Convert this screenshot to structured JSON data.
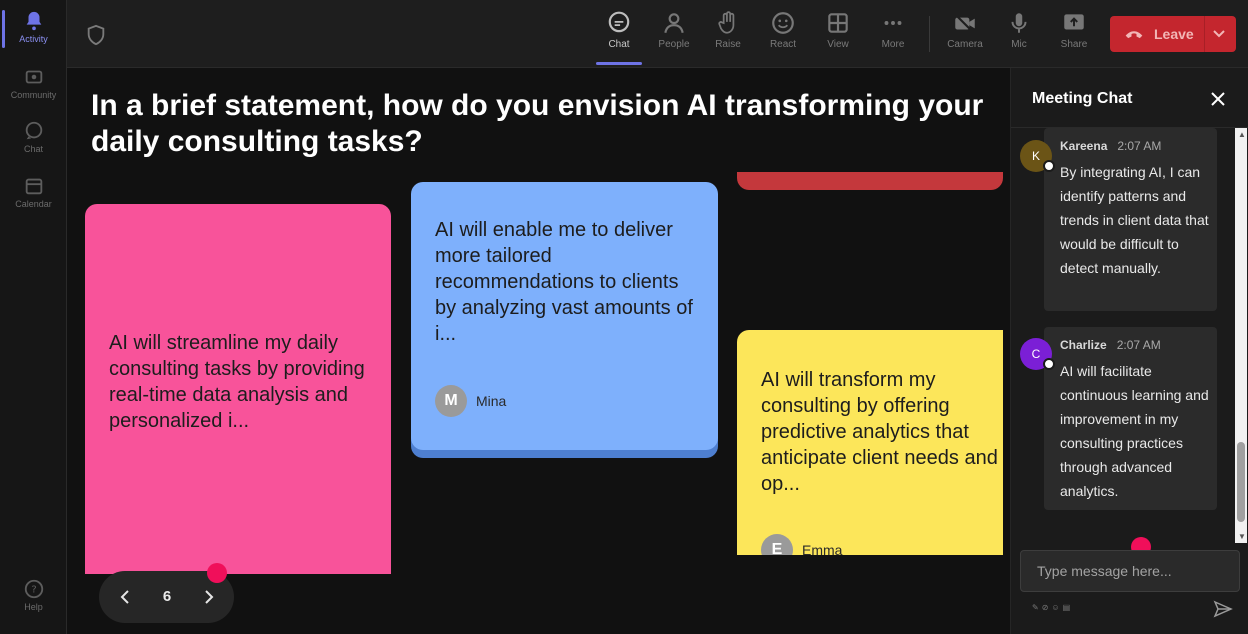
{
  "rail": {
    "items": [
      {
        "label": "Activity",
        "icon": "bell-icon"
      },
      {
        "label": "Community",
        "icon": "community-icon"
      },
      {
        "label": "Chat",
        "icon": "chat-icon"
      },
      {
        "label": "Calendar",
        "icon": "calendar-icon"
      },
      {
        "label": "Help",
        "icon": "help-icon"
      }
    ]
  },
  "toolbar": {
    "chat": "Chat",
    "people": "People",
    "raise": "Raise",
    "react": "React",
    "view": "View",
    "more": "More",
    "camera": "Camera",
    "mic": "Mic",
    "share": "Share",
    "leave": "Leave"
  },
  "stage": {
    "question": "In a brief statement, how do you envision AI transforming your daily consulting tasks?",
    "cards": [
      {
        "text": "AI will streamline my daily consulting tasks by providing real-time data analysis and personalized i...",
        "color": "#f8539a"
      },
      {
        "text": "AI will enable me to deliver more tailored recommendations to clients by analyzing vast amounts of i...",
        "author": "Mina",
        "initial": "M",
        "color": "#7eb0fc"
      },
      {
        "text": "AI will transform my consulting by offering predictive analytics that anticipate client needs and op...",
        "author": "Emma",
        "initial": "E",
        "color": "#fce65a"
      }
    ],
    "pager": {
      "page": "6"
    }
  },
  "chat": {
    "title": "Meeting Chat",
    "messages": [
      {
        "name": "Kareena",
        "time": "2:07 AM",
        "initial": "K",
        "avatar_color": "#6b5416",
        "text": "By integrating AI, I can identify patterns and trends in client data that would be difficult to detect manually."
      },
      {
        "name": "Charlize",
        "time": "2:07 AM",
        "initial": "C",
        "avatar_color": "#7b1fd6",
        "text": "AI will facilitate continuous learning and improvement in my consulting practices through advanced analytics."
      }
    ],
    "input_placeholder": "Type message here..."
  }
}
